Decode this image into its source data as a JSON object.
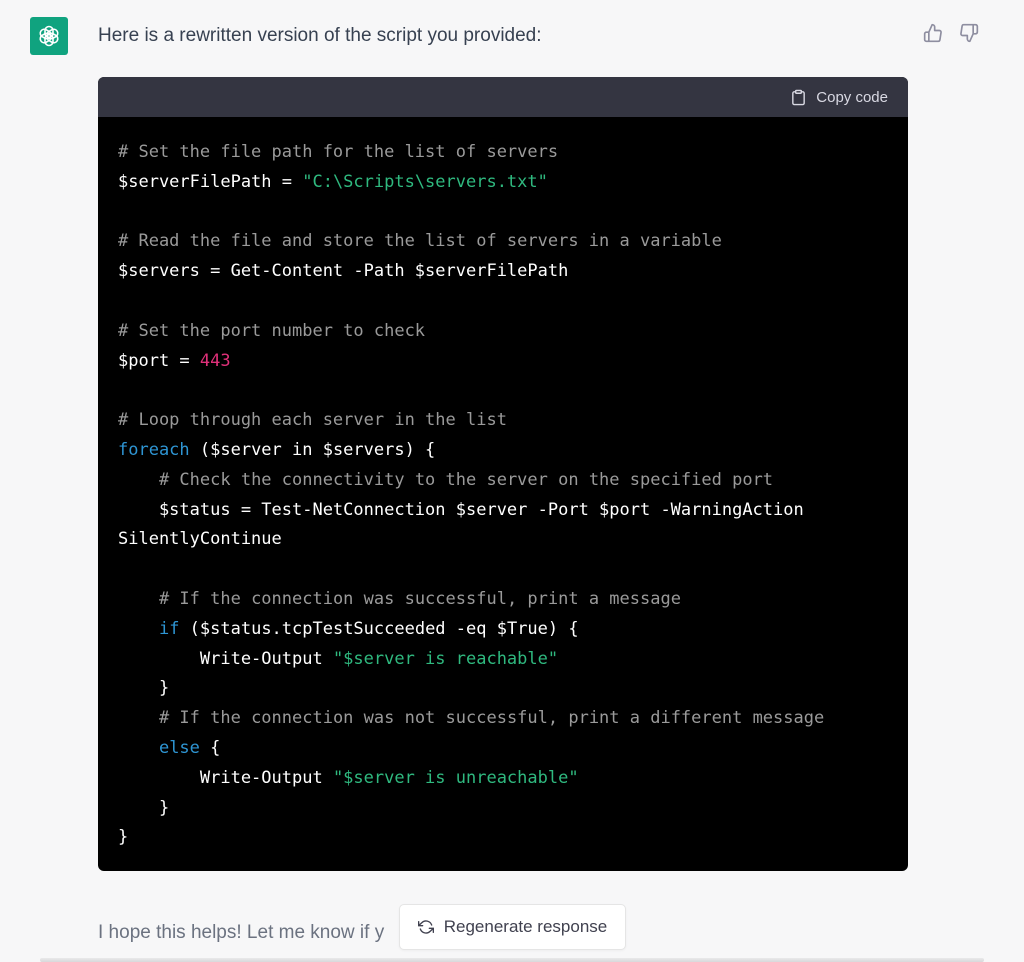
{
  "message": {
    "intro": "Here is a rewritten version of the script you provided:",
    "outro": "I hope this helps! Let me know if y"
  },
  "code_block": {
    "copy_label": "Copy code",
    "lines": [
      [
        {
          "t": "comment",
          "v": "# Set the file path for the list of servers"
        }
      ],
      [
        {
          "t": "plain",
          "v": "$serverFilePath = "
        },
        {
          "t": "string",
          "v": "\"C:\\Scripts\\servers.txt\""
        }
      ],
      [],
      [
        {
          "t": "comment",
          "v": "# Read the file and store the list of servers in a variable"
        }
      ],
      [
        {
          "t": "plain",
          "v": "$servers = Get-Content -Path $serverFilePath"
        }
      ],
      [],
      [
        {
          "t": "comment",
          "v": "# Set the port number to check"
        }
      ],
      [
        {
          "t": "plain",
          "v": "$port = "
        },
        {
          "t": "number",
          "v": "443"
        }
      ],
      [],
      [
        {
          "t": "comment",
          "v": "# Loop through each server in the list"
        }
      ],
      [
        {
          "t": "keyword",
          "v": "foreach"
        },
        {
          "t": "plain",
          "v": " ($server in $servers) {"
        }
      ],
      [
        {
          "t": "plain",
          "v": "    "
        },
        {
          "t": "comment",
          "v": "# Check the connectivity to the server on the specified port"
        }
      ],
      [
        {
          "t": "plain",
          "v": "    $status = Test-NetConnection $server -Port $port -WarningAction"
        }
      ],
      [
        {
          "t": "plain",
          "v": "SilentlyContinue"
        }
      ],
      [],
      [
        {
          "t": "plain",
          "v": "    "
        },
        {
          "t": "comment",
          "v": "# If the connection was successful, print a message"
        }
      ],
      [
        {
          "t": "plain",
          "v": "    "
        },
        {
          "t": "keyword",
          "v": "if"
        },
        {
          "t": "plain",
          "v": " ($status.tcpTestSucceeded -eq $True) {"
        }
      ],
      [
        {
          "t": "plain",
          "v": "        Write-Output "
        },
        {
          "t": "string",
          "v": "\"$server is reachable\""
        }
      ],
      [
        {
          "t": "plain",
          "v": "    }"
        }
      ],
      [
        {
          "t": "plain",
          "v": "    "
        },
        {
          "t": "comment",
          "v": "# If the connection was not successful, print a different message"
        }
      ],
      [
        {
          "t": "plain",
          "v": "    "
        },
        {
          "t": "keyword",
          "v": "else"
        },
        {
          "t": "plain",
          "v": " {"
        }
      ],
      [
        {
          "t": "plain",
          "v": "        Write-Output "
        },
        {
          "t": "string",
          "v": "\"$server is unreachable\""
        }
      ],
      [
        {
          "t": "plain",
          "v": "    }"
        }
      ],
      [
        {
          "t": "plain",
          "v": "}"
        }
      ]
    ]
  },
  "actions": {
    "regenerate_label": "Regenerate response"
  },
  "icons": {
    "avatar": "openai-logo-icon",
    "thumbs_up": "thumbs-up-icon",
    "thumbs_down": "thumbs-down-icon",
    "copy": "clipboard-icon",
    "regenerate": "refresh-icon"
  },
  "colors": {
    "brand": "#10a37f",
    "code_background": "#000000",
    "code_header": "#343541",
    "comment": "#9a9a9a",
    "string": "#2fb97f",
    "number": "#df3079",
    "keyword": "#2e95d3"
  }
}
